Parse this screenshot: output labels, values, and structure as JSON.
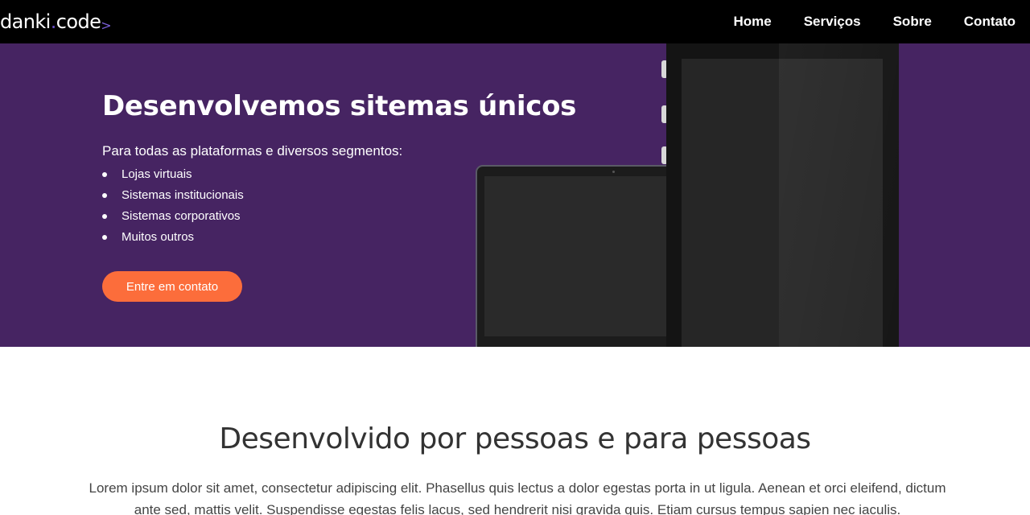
{
  "header": {
    "logo": {
      "part1": "danki",
      "dot": ".",
      "part2": "code",
      "chevron": ">"
    },
    "nav": [
      {
        "label": "Home"
      },
      {
        "label": "Serviços"
      },
      {
        "label": "Sobre"
      },
      {
        "label": "Contato"
      }
    ]
  },
  "hero": {
    "title": "Desenvolvemos sitemas únicos",
    "subtitle": "Para todas as plataformas e diversos segmentos:",
    "items": [
      "Lojas virtuais",
      "Sistemas institucionais",
      "Sistemas corporativos",
      "Muitos outros"
    ],
    "cta_label": "Entre em contato"
  },
  "section": {
    "title": "Desenvolvido por pessoas e para pessoas",
    "text": "Lorem ipsum dolor sit amet, consectetur adipiscing elit. Phasellus quis lectus a dolor egestas porta in ut ligula. Aenean et orci eleifend, dictum ante sed, mattis velit. Suspendisse egestas felis lacus, sed hendrerit nisi gravida quis. Etiam cursus tempus sapien nec iaculis."
  },
  "colors": {
    "header_bg": "#000000",
    "hero_bg": "#462462",
    "cta_bg": "#fc6d3b",
    "logo_accent": "#6a4fc8"
  },
  "icons": {
    "list_bullet": "bullet-icon",
    "devices": "devices-illustration"
  }
}
